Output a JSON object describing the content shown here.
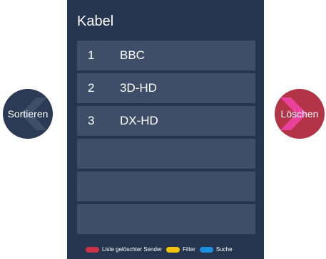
{
  "panel": {
    "title": "Kabel",
    "channels": [
      {
        "number": "1",
        "name": "BBC"
      },
      {
        "number": "2",
        "name": "3D-HD"
      },
      {
        "number": "3",
        "name": "DX-HD"
      },
      {
        "number": "",
        "name": ""
      },
      {
        "number": "",
        "name": ""
      },
      {
        "number": "",
        "name": ""
      }
    ]
  },
  "left_button": {
    "label": "Sortieren",
    "icon": "chevron-left-icon"
  },
  "right_button": {
    "label": "Löschen",
    "icon": "chevron-right-icon"
  },
  "legend": [
    {
      "label": "Liste gelöschter Sender",
      "color": "#c9344b"
    },
    {
      "label": "Filter",
      "color": "#f2c500"
    },
    {
      "label": "Suche",
      "color": "#1c8fe0"
    }
  ]
}
